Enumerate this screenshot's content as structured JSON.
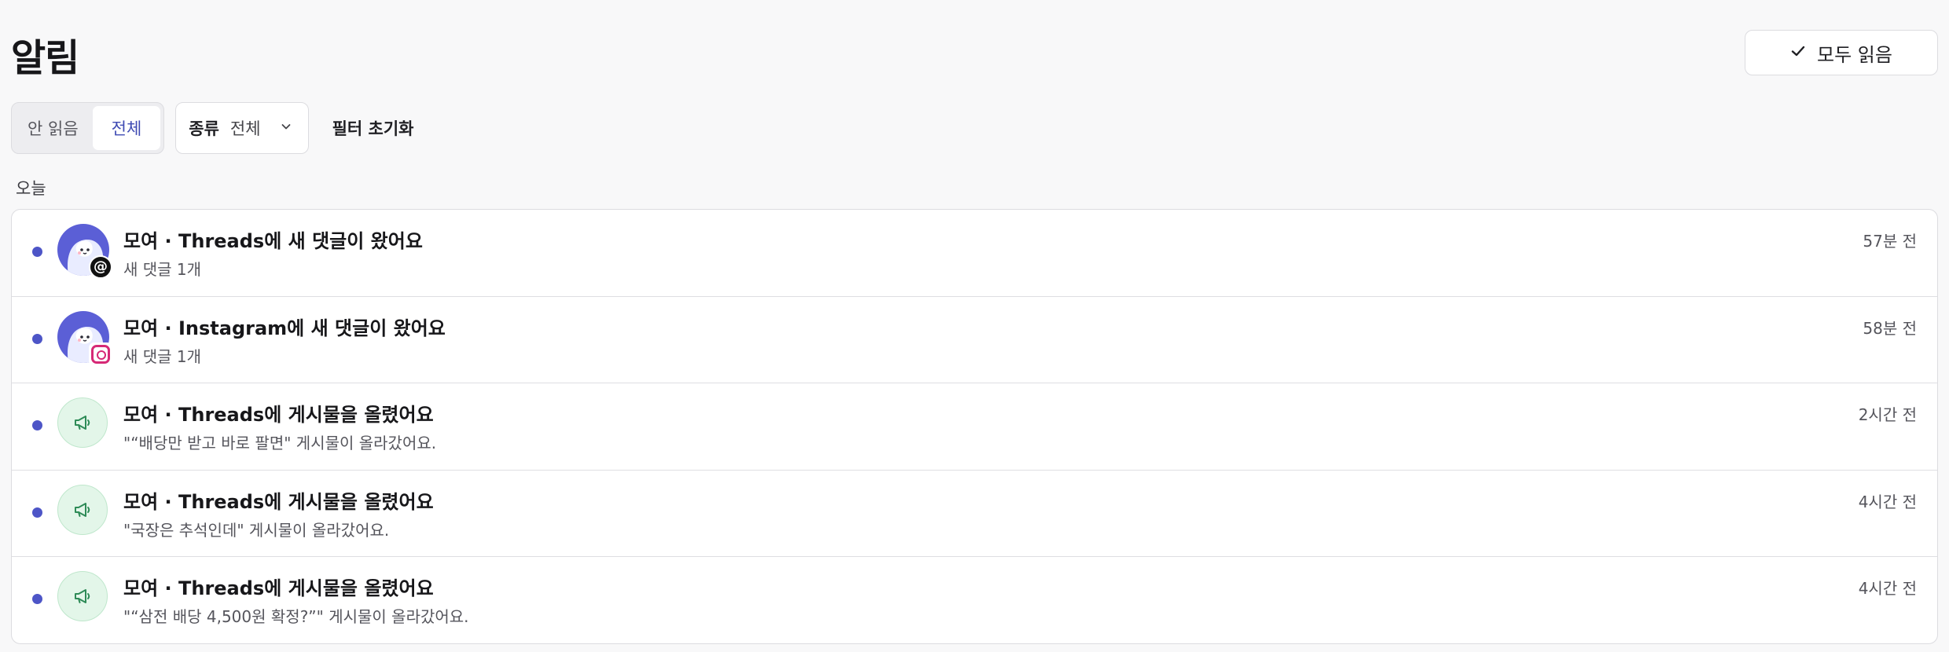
{
  "header": {
    "title": "알림",
    "mark_all_label": "모두 읽음"
  },
  "filters": {
    "segments": [
      {
        "label": "안 읽음"
      },
      {
        "label": "전체"
      }
    ],
    "type_label": "종류",
    "type_value": "전체",
    "reset_label": "필터 초기화"
  },
  "section": {
    "label": "오늘"
  },
  "notifications": [
    {
      "title": "모여 · Threads에 새 댓글이 왔어요",
      "subtitle": "새 댓글 1개",
      "time": "57분 전",
      "icon": "avatar-threads"
    },
    {
      "title": "모여 · Instagram에 새 댓글이 왔어요",
      "subtitle": "새 댓글 1개",
      "time": "58분 전",
      "icon": "avatar-instagram"
    },
    {
      "title": "모여 · Threads에 게시물을 올렸어요",
      "subtitle": "\"“배당만 받고 바로 팔면\" 게시물이 올라갔어요.",
      "time": "2시간 전",
      "icon": "megaphone-icon"
    },
    {
      "title": "모여 · Threads에 게시물을 올렸어요",
      "subtitle": "\"국장은 추석인데\" 게시물이 올라갔어요.",
      "time": "4시간 전",
      "icon": "megaphone-icon"
    },
    {
      "title": "모여 · Threads에 게시물을 올렸어요",
      "subtitle": "\"“삼전 배당 4,500원 확정?”\" 게시물이 올라갔어요.",
      "time": "4시간 전",
      "icon": "megaphone-icon"
    }
  ],
  "colors": {
    "unread_dot": "#4d55c7",
    "active_segment_text": "#3f4bb3",
    "megaphone_bg": "#e3f6e9",
    "megaphone_icon": "#2e8b57"
  }
}
